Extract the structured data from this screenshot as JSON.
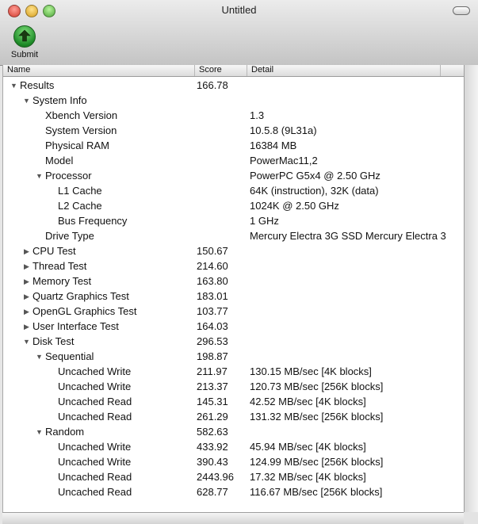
{
  "window": {
    "title": "Untitled"
  },
  "toolbar": {
    "submit_label": "Submit",
    "submit_icon": "upload-arrow-icon"
  },
  "table": {
    "columns": [
      "Name",
      "Score",
      "Detail"
    ],
    "rows": [
      {
        "name": "Results",
        "score": "166.78",
        "detail": "",
        "indent": 0,
        "expander": "open"
      },
      {
        "name": "System Info",
        "score": "",
        "detail": "",
        "indent": 1,
        "expander": "open"
      },
      {
        "name": "Xbench Version",
        "score": "",
        "detail": "1.3",
        "indent": 2,
        "expander": "none"
      },
      {
        "name": "System Version",
        "score": "",
        "detail": "10.5.8 (9L31a)",
        "indent": 2,
        "expander": "none"
      },
      {
        "name": "Physical RAM",
        "score": "",
        "detail": "16384 MB",
        "indent": 2,
        "expander": "none"
      },
      {
        "name": "Model",
        "score": "",
        "detail": "PowerMac11,2",
        "indent": 2,
        "expander": "none"
      },
      {
        "name": "Processor",
        "score": "",
        "detail": "PowerPC G5x4 @ 2.50 GHz",
        "indent": 2,
        "expander": "open"
      },
      {
        "name": "L1 Cache",
        "score": "",
        "detail": "64K (instruction), 32K (data)",
        "indent": 3,
        "expander": "none"
      },
      {
        "name": "L2 Cache",
        "score": "",
        "detail": "1024K @ 2.50 GHz",
        "indent": 3,
        "expander": "none"
      },
      {
        "name": "Bus Frequency",
        "score": "",
        "detail": "1 GHz",
        "indent": 3,
        "expander": "none"
      },
      {
        "name": "Drive Type",
        "score": "",
        "detail": "Mercury Electra 3G SSD Mercury Electra 3",
        "indent": 2,
        "expander": "none"
      },
      {
        "name": "CPU Test",
        "score": "150.67",
        "detail": "",
        "indent": 1,
        "expander": "closed"
      },
      {
        "name": "Thread Test",
        "score": "214.60",
        "detail": "",
        "indent": 1,
        "expander": "closed"
      },
      {
        "name": "Memory Test",
        "score": "163.80",
        "detail": "",
        "indent": 1,
        "expander": "closed"
      },
      {
        "name": "Quartz Graphics Test",
        "score": "183.01",
        "detail": "",
        "indent": 1,
        "expander": "closed"
      },
      {
        "name": "OpenGL Graphics Test",
        "score": "103.77",
        "detail": "",
        "indent": 1,
        "expander": "closed"
      },
      {
        "name": "User Interface Test",
        "score": "164.03",
        "detail": "",
        "indent": 1,
        "expander": "closed"
      },
      {
        "name": "Disk Test",
        "score": "296.53",
        "detail": "",
        "indent": 1,
        "expander": "open"
      },
      {
        "name": "Sequential",
        "score": "198.87",
        "detail": "",
        "indent": 2,
        "expander": "open"
      },
      {
        "name": "Uncached Write",
        "score": "211.97",
        "detail": "130.15 MB/sec [4K blocks]",
        "indent": 3,
        "expander": "none"
      },
      {
        "name": "Uncached Write",
        "score": "213.37",
        "detail": "120.73 MB/sec [256K blocks]",
        "indent": 3,
        "expander": "none"
      },
      {
        "name": "Uncached Read",
        "score": "145.31",
        "detail": "42.52 MB/sec [4K blocks]",
        "indent": 3,
        "expander": "none"
      },
      {
        "name": "Uncached Read",
        "score": "261.29",
        "detail": "131.32 MB/sec [256K blocks]",
        "indent": 3,
        "expander": "none"
      },
      {
        "name": "Random",
        "score": "582.63",
        "detail": "",
        "indent": 2,
        "expander": "open"
      },
      {
        "name": "Uncached Write",
        "score": "433.92",
        "detail": "45.94 MB/sec [4K blocks]",
        "indent": 3,
        "expander": "none"
      },
      {
        "name": "Uncached Write",
        "score": "390.43",
        "detail": "124.99 MB/sec [256K blocks]",
        "indent": 3,
        "expander": "none"
      },
      {
        "name": "Uncached Read",
        "score": "2443.96",
        "detail": "17.32 MB/sec [4K blocks]",
        "indent": 3,
        "expander": "none"
      },
      {
        "name": "Uncached Read",
        "score": "628.77",
        "detail": "116.67 MB/sec [256K blocks]",
        "indent": 3,
        "expander": "none"
      }
    ]
  }
}
